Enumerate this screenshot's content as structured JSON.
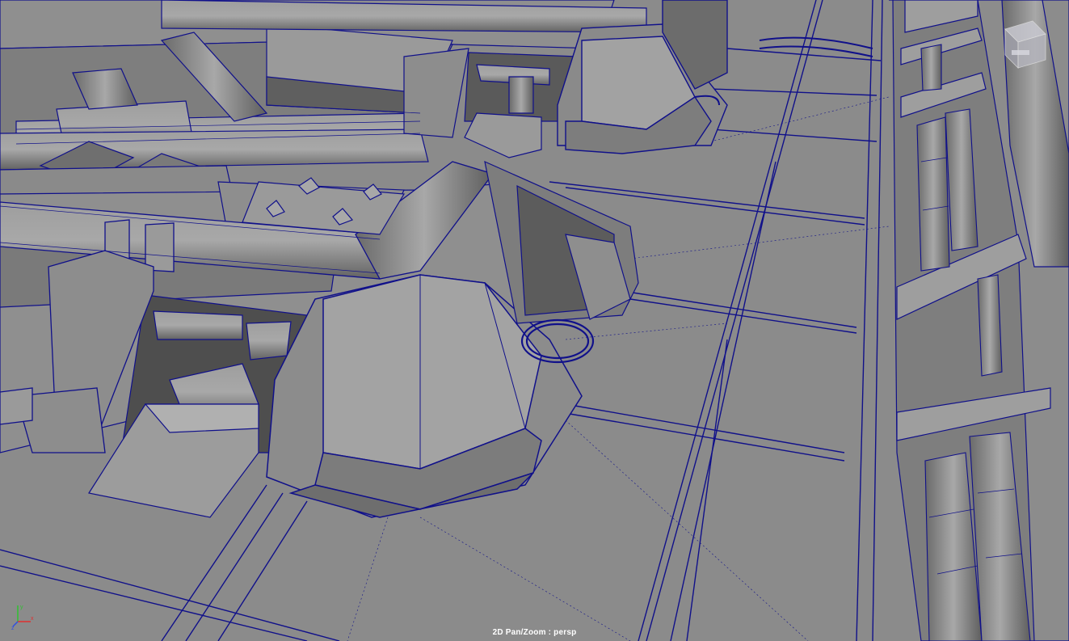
{
  "viewport": {
    "status_label": "2D Pan/Zoom : persp",
    "camera": "persp",
    "mode": "2D Pan/Zoom"
  },
  "colors": {
    "wireframe": "#10108a",
    "surface": "#8a8a8a",
    "surface_light": "#a2a2a2",
    "surface_dark": "#5a5a5a",
    "shadow": "#454545",
    "axis_x": "#e03030",
    "axis_y": "#30c030",
    "axis_z": "#3050e0"
  },
  "icons": {
    "axis_gizmo": "xyz-axis-icon",
    "view_cube": "view-cube-icon"
  }
}
